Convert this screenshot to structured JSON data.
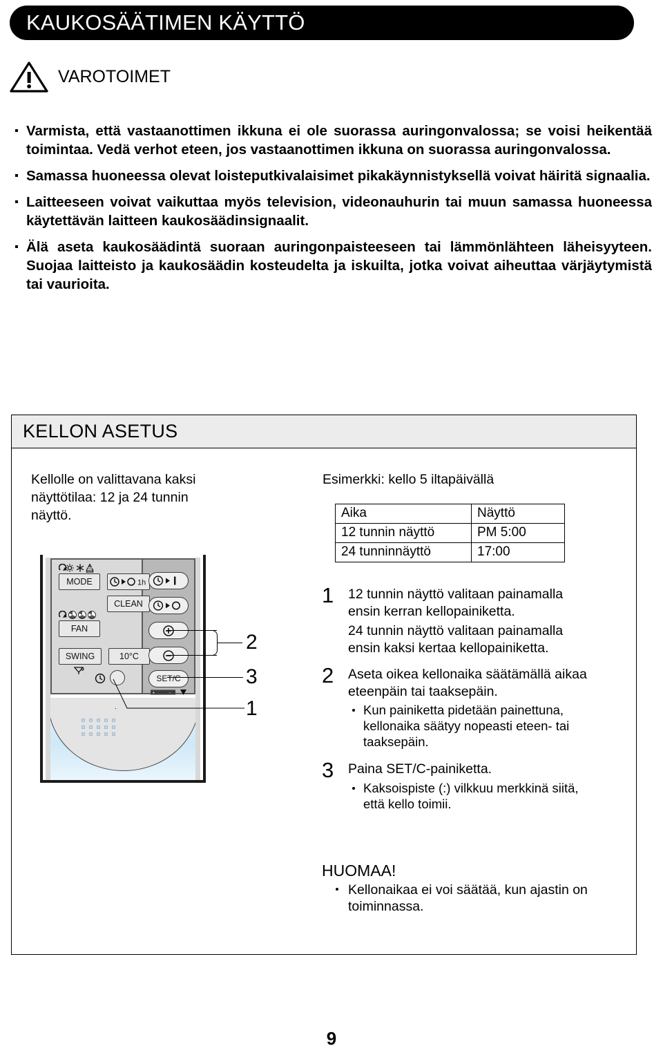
{
  "header": {
    "title": "KAUKOSÄÄTIMEN KÄYTTÖ",
    "caution_label": "VAROTOIMET",
    "warning_icon": "warning-triangle-icon"
  },
  "cautions": [
    "Varmista, että vastaanottimen ikkuna ei ole suorassa auringonvalossa; se voisi heikentää toimintaa. Vedä verhot eteen, jos vastaanottimen ikkuna on suorassa auringonvalossa.",
    "Samassa huoneessa olevat loisteputkivalaisimet pikakäynnistyksellä voivat häiritä signaalia.",
    "Laitteeseen voivat vaikuttaa myös television, videonauhurin tai muun samassa huoneessa käytettävän laitteen kaukosäädinsignaalit.",
    "Älä aseta kaukosäädintä suoraan auringonpaisteeseen tai lämmönlähteen läheisyyteen. Suojaa laitteisto ja kaukosäädin kosteudelta ja iskuilta, jotka voivat aiheuttaa värjäytymistä tai vaurioita."
  ],
  "section": {
    "title": "KELLON ASETUS",
    "lead_left": "Kellolle on valittavana kaksi näyttötilaa: 12 ja 24 tunnin näyttö.",
    "example_caption": "Esimerkki: kello 5 iltapäivällä"
  },
  "example_table": {
    "headers": [
      "Aika",
      "Näyttö"
    ],
    "rows": [
      [
        "12 tunnin näyttö",
        "PM 5:00"
      ],
      [
        "24 tunninnäyttö",
        "17:00"
      ]
    ]
  },
  "remote": {
    "mode_button": "MODE",
    "timer_1h_button": "1h",
    "clean_button": "CLEAN",
    "fan_button": "FAN",
    "swing_button": "SWING",
    "temp10_button": "10°C",
    "setc_button": "SET/C",
    "mode_icons": [
      "auto-swirl-icon",
      "sun-icon",
      "snowflake-icon",
      "water-drop-icon"
    ],
    "fan_icons": [
      "auto-swirl-icon",
      "fan-low-icon",
      "fan-med-icon",
      "fan-high-icon"
    ],
    "swing_icon": "louver-icon",
    "timer_on_icon": "clock-timer-on-icon",
    "timer_off_icon": "clock-timer-off-icon",
    "plus_icon": "plus-circle-icon",
    "minus_icon": "minus-circle-icon",
    "clock_icon": "clock-icon",
    "battery_icon": "battery-icon",
    "callouts": [
      "1",
      "2",
      "3"
    ]
  },
  "steps": [
    {
      "num": "1",
      "text": "12 tunnin näyttö valitaan painamalla ensin kerran kellopainiketta.",
      "text2": "24 tunnin näyttö valitaan painamalla ensin kaksi kertaa kellopainiketta."
    },
    {
      "num": "2",
      "text": "Aseta oikea kellonaika säätämällä aikaa eteenpäin tai taaksepäin.",
      "sub": "Kun painiketta pidetään painettuna, kellonaika säätyy nopeasti eteen- tai taaksepäin."
    },
    {
      "num": "3",
      "text": "Paina SET/C-painiketta.",
      "sub": "Kaksoispiste (:) vilkkuu merkkinä siitä, että kello toimii."
    }
  ],
  "note": {
    "title": "HUOMAA!",
    "body": "Kellonaikaa ei voi säätää, kun ajastin on toiminnassa."
  },
  "page_number": "9",
  "colors": {
    "banner": "#000000",
    "section_head": "#ececec",
    "remote_panel": "#d9d9d9",
    "remote_panel_right": "#b8b8b8",
    "lower_face": "#cfe8f7"
  }
}
